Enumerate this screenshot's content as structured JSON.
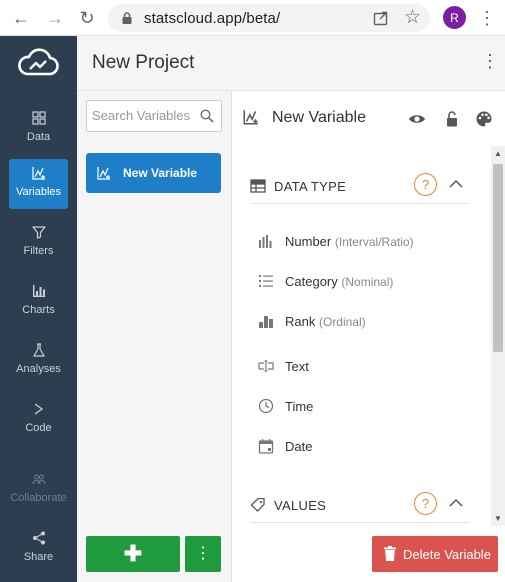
{
  "browser": {
    "url": "statscloud.app/beta/",
    "profile_initial": "R"
  },
  "app": {
    "project_title": "New Project"
  },
  "nav": {
    "items": [
      {
        "label": "Data"
      },
      {
        "label": "Variables"
      },
      {
        "label": "Filters"
      },
      {
        "label": "Charts"
      },
      {
        "label": "Analyses"
      },
      {
        "label": "Code"
      },
      {
        "label": "Collaborate"
      },
      {
        "label": "Share"
      }
    ]
  },
  "variables": {
    "search_placeholder": "Search Variables",
    "items": [
      {
        "label": "New Variable"
      }
    ]
  },
  "detail": {
    "variable_name": "New Variable",
    "data_type_section": {
      "title": "DATA TYPE",
      "help": "?"
    },
    "options": [
      {
        "label": "Number",
        "hint": "(Interval/Ratio)",
        "icon": "bar-chart-icon"
      },
      {
        "label": "Category",
        "hint": "(Nominal)",
        "icon": "list-icon"
      },
      {
        "label": "Rank",
        "hint": "(Ordinal)",
        "icon": "rank-icon"
      },
      {
        "label": "Text",
        "hint": "",
        "icon": "text-field-icon"
      },
      {
        "label": "Time",
        "hint": "",
        "icon": "clock-icon"
      },
      {
        "label": "Date",
        "hint": "",
        "icon": "calendar-icon"
      }
    ],
    "values_section": {
      "title": "VALUES",
      "help": "?"
    },
    "delete_label": "Delete Variable"
  },
  "colors": {
    "sidebar": "#2d3e50",
    "active_blue": "#1e7ec8",
    "add_green": "#1f9a3e",
    "delete_red": "#d9534f",
    "help_orange": "#e08a2c",
    "profile_purple": "#7b1fa2"
  }
}
